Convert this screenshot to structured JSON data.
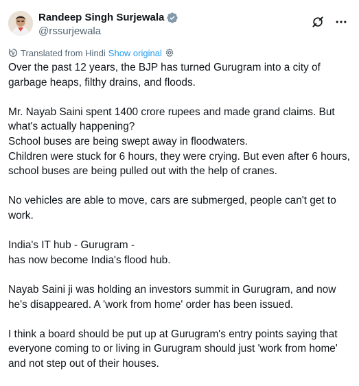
{
  "author": {
    "display_name": "Randeep Singh Surjewala",
    "handle": "@rssurjewala",
    "verified": true
  },
  "translation": {
    "label": "Translated from Hindi",
    "show_original": "Show original"
  },
  "paragraphs": [
    {
      "lines": [
        "Over the past 12 years, the BJP has turned Gurugram into a city of",
        "garbage heaps, filthy drains, and floods."
      ]
    },
    {
      "lines": [
        "Mr. Nayab Saini spent 1400 crore rupees and made grand claims. But",
        "what's actually happening?",
        "School buses are being swept away in floodwaters.",
        "Children were stuck for 6 hours, they were crying. But even after 6 hours,",
        "school buses are being pulled out with the help of cranes."
      ]
    },
    {
      "lines": [
        "No vehicles are able to move, cars are submerged, people can't get to",
        "work."
      ]
    },
    {
      "lines": [
        "India's IT hub - Gurugram -",
        "has now become India's flood hub."
      ]
    },
    {
      "lines": [
        "Nayab Saini ji was holding an investors summit in Gurugram, and now",
        "he's disappeared. A 'work from home' order has been issued."
      ]
    },
    {
      "lines": [
        "I think a board should be put up at Gurugram's entry points saying that",
        "everyone coming to or living in Gurugram should just 'work from home'",
        "and not step out of their houses."
      ]
    }
  ],
  "colors": {
    "text": "#0f1419",
    "secondary": "#536471",
    "link": "#1d9bf0",
    "verified": "#829aab"
  }
}
